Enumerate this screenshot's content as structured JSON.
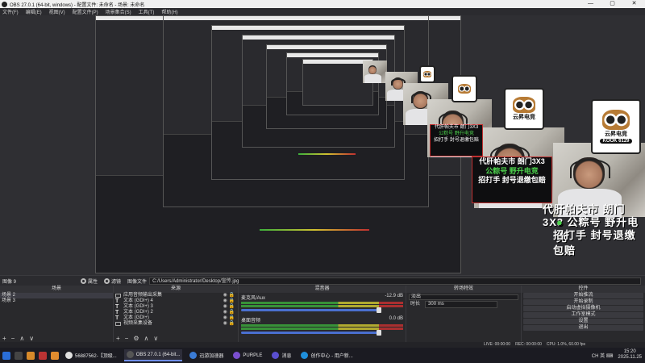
{
  "window": {
    "title": "OBS 27.0.1 (64-bit, windows) - 配置文件: 未命名 - 场景: 未命名",
    "min": "—",
    "max": "▢",
    "close": "✕"
  },
  "menu": [
    "文件(F)",
    "编辑(E)",
    "视图(V)",
    "配置文件(P)",
    "场景集合(S)",
    "工具(T)",
    "帮助(H)"
  ],
  "overlay": {
    "banner_line1": "代肝帕夫市 朗门3X3",
    "banner_line2": "公粽号 野升电竞",
    "banner_line3": "招打手 封号退缴包赔",
    "logo_text": "云昇电竞",
    "logo_id": "6129",
    "kook": "KOOK"
  },
  "sceneinfo": {
    "label": "图像 9",
    "props": "属性",
    "filters": "滤镜",
    "image_file": "图像文件",
    "path": "C:/Users/Administrator/Desktop/宣传.jpg"
  },
  "scenes": {
    "header": "场景",
    "items": [
      "场景 2",
      "场景 3"
    ],
    "add": "+",
    "remove": "−",
    "up": "∧",
    "down": "∨"
  },
  "sources": {
    "header": "来源",
    "items": [
      {
        "label": "应用音频输出采集",
        "icon": "app-audio-icon"
      },
      {
        "label": "文本 (GDI+) 4",
        "icon": "text-icon"
      },
      {
        "label": "文本 (GDI+) 3",
        "icon": "text-icon"
      },
      {
        "label": "文本 (GDI+) 2",
        "icon": "text-icon"
      },
      {
        "label": "文本 (GDI+)",
        "icon": "text-icon"
      },
      {
        "label": "视频采集设备",
        "icon": "camera-icon"
      }
    ]
  },
  "mixer": {
    "header": "混音器",
    "tracks": [
      {
        "name": "麦克风/Aux",
        "db": "-12.9 dB"
      },
      {
        "name": "桌面音频",
        "db": "0.0 dB"
      }
    ]
  },
  "transitions": {
    "header": "转场特效",
    "value": "淡出",
    "duration_label": "时长",
    "duration": "300 ms"
  },
  "controls": {
    "header": "控件",
    "buttons": [
      "开始推流",
      "开始录制",
      "启动虚拟摄像机",
      "工作室模式",
      "设置",
      "退出"
    ]
  },
  "status": {
    "live": "LIVE: 00:00:00",
    "rec": "REC: 00:00:00",
    "cpu": "CPU: 1.0%, 60.00 fps"
  },
  "taskbar": {
    "items": [
      {
        "label": "56887562-【顶级...",
        "color": "#e0e0e0"
      },
      {
        "label": "OBS 27.0.1 (64-bit...",
        "color": "#333"
      },
      {
        "label": "迅游加速器",
        "color": "#3a7bd5"
      },
      {
        "label": "PURPLE",
        "color": "#7b4fd0"
      },
      {
        "label": "消息",
        "color": "#5a4fd0"
      },
      {
        "label": "创作中心 - 用户新...",
        "color": "#1f8fdb"
      }
    ],
    "tray": "CH  英  ⌨",
    "time": "15:20",
    "date": "2025.11.25"
  }
}
